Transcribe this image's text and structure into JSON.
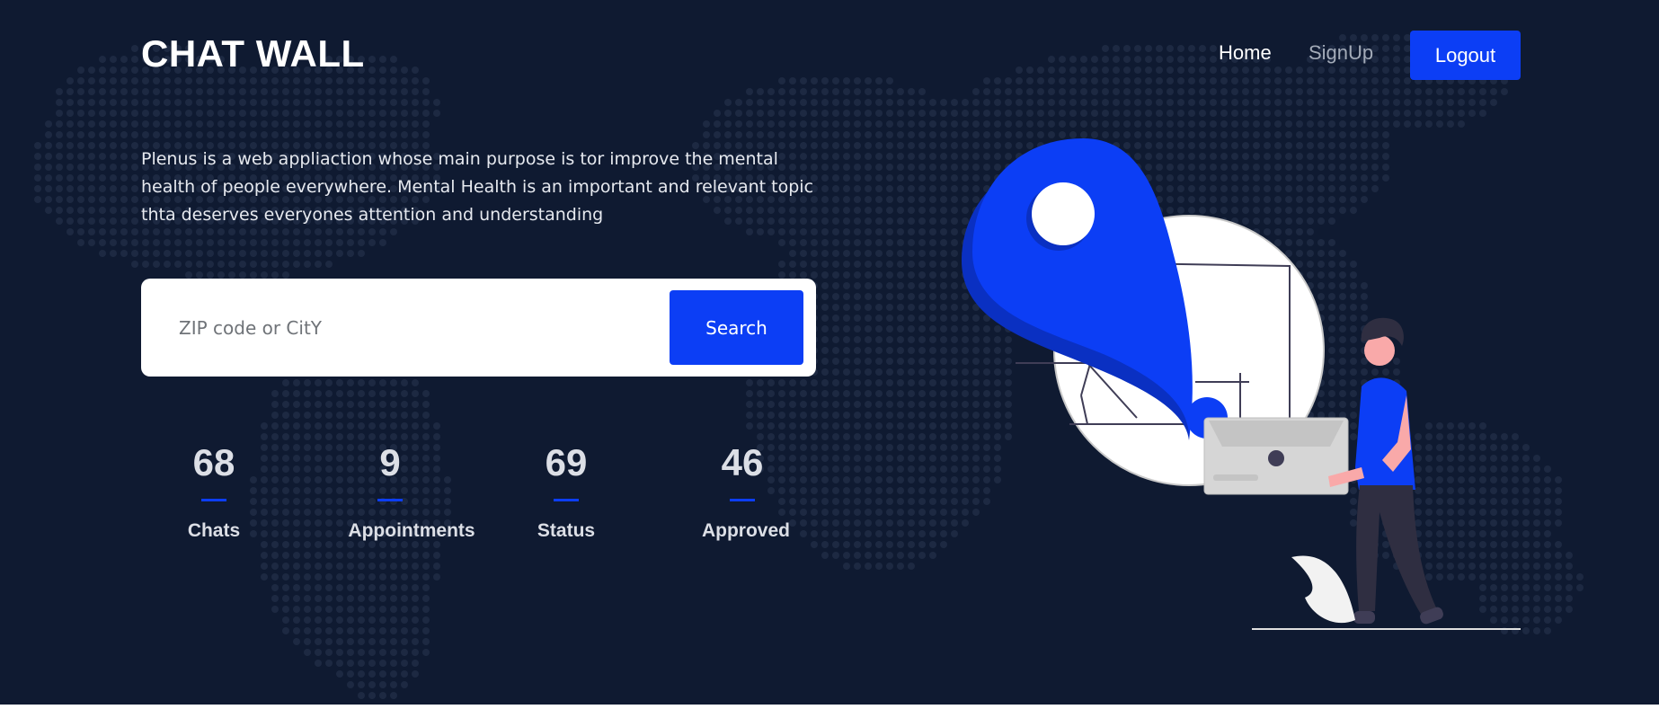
{
  "header": {
    "brand": "CHAT WALL",
    "nav": {
      "home": "Home",
      "signup": "SignUp",
      "logout": "Logout"
    }
  },
  "hero": {
    "description": "Plenus is a web appliaction whose main purpose is tor improve the mental health of people everywhere. Mental Health is an important and relevant topic thta deserves everyones attention and understanding",
    "search": {
      "placeholder": "ZIP code or CitY",
      "value": "",
      "button_label": "Search"
    },
    "stats": [
      {
        "value": "68",
        "label": "Chats"
      },
      {
        "value": "9",
        "label": "Appointments"
      },
      {
        "value": "69",
        "label": "Status"
      },
      {
        "value": "46",
        "label": "Approved"
      }
    ]
  },
  "colors": {
    "background": "#0f1a31",
    "accent": "#0c3ef5",
    "dots": "#1d2942"
  }
}
